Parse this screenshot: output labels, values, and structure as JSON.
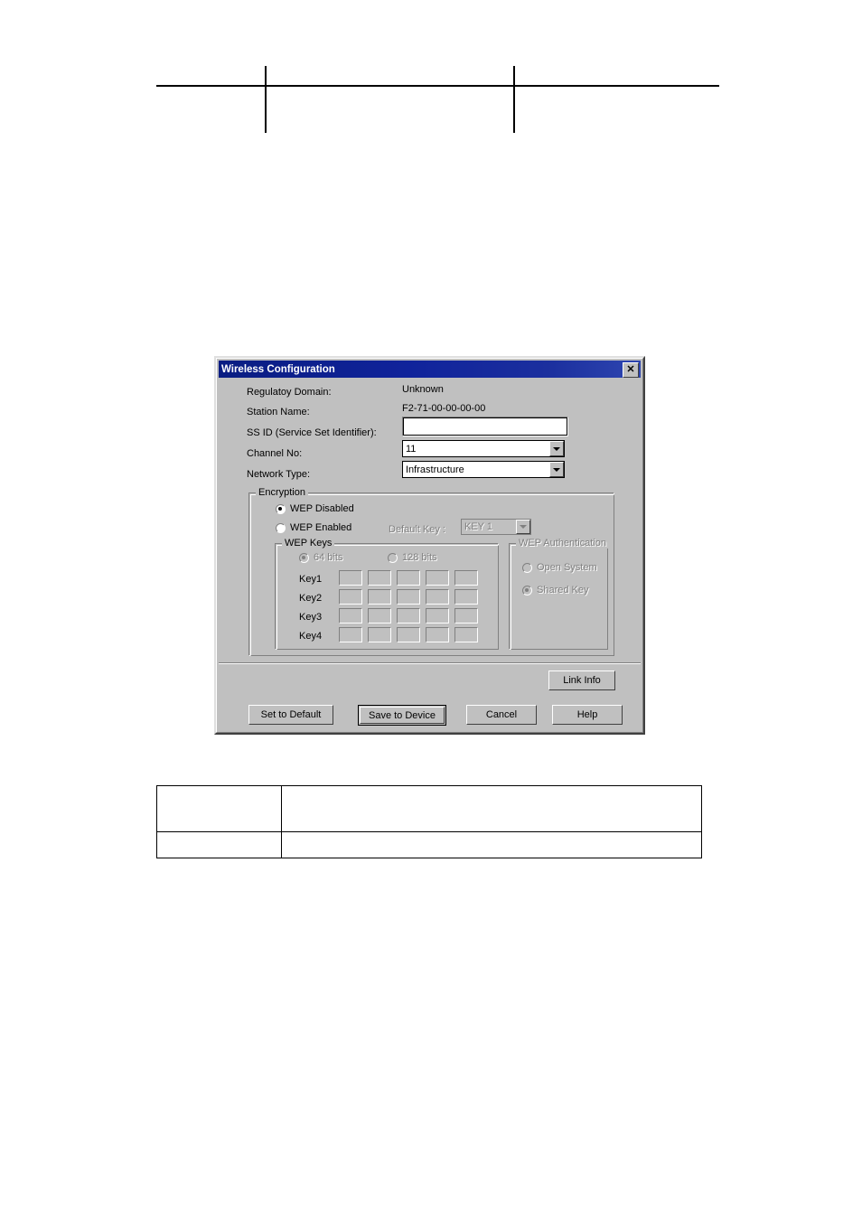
{
  "document": {
    "header_rule": "",
    "footer_table": {
      "rows": [
        {
          "cells": [
            "",
            ""
          ]
        },
        {
          "cells": [
            "",
            ""
          ]
        }
      ]
    }
  },
  "dialog": {
    "title": "Wireless Configuration",
    "close_icon": "✕",
    "fields": {
      "regulatory_domain_label": "Regulatoy Domain:",
      "regulatory_domain_value": "Unknown",
      "station_name_label": "Station Name:",
      "station_name_value": "F2-71-00-00-00-00",
      "ssid_label": "SS ID (Service Set Identifier):",
      "ssid_value": "",
      "ssid_placeholder": "",
      "channel_label": "Channel No:",
      "channel_value": "11",
      "channel_options": [
        "11"
      ],
      "network_type_label": "Network Type:",
      "network_type_value": "Infrastructure",
      "network_type_options": [
        "Infrastructure"
      ]
    },
    "encryption": {
      "group_title": "Encryption",
      "wep_disabled_label": "WEP Disabled",
      "wep_enabled_label": "WEP Enabled",
      "default_key_label": "Default Key :",
      "default_key_value": "KEY 1",
      "default_key_options": [
        "KEY 1"
      ],
      "wep_keys": {
        "group_title": "WEP Keys",
        "bits_64_label": "64 bits",
        "bits_128_label": "128 bits",
        "rows": [
          {
            "label": "Key1",
            "cells": [
              "",
              "",
              "",
              "",
              ""
            ]
          },
          {
            "label": "Key2",
            "cells": [
              "",
              "",
              "",
              "",
              ""
            ]
          },
          {
            "label": "Key3",
            "cells": [
              "",
              "",
              "",
              "",
              ""
            ]
          },
          {
            "label": "Key4",
            "cells": [
              "",
              "",
              "",
              "",
              ""
            ]
          }
        ]
      },
      "wep_auth": {
        "group_title": "WEP Authentication",
        "open_system_label": "Open System",
        "shared_key_label": "Shared Key"
      }
    },
    "buttons": {
      "link_info": "Link Info",
      "set_to_default": "Set to Default",
      "save_to_device": "Save to Device",
      "cancel": "Cancel",
      "help": "Help"
    }
  },
  "colors": {
    "dialog_face": "#c0c0c0",
    "titlebar_start": "#0a1d82",
    "titlebar_end": "#2e45b0",
    "titlebar_text": "#ffffff",
    "disabled_text": "#808080",
    "field_bg": "#ffffff"
  }
}
